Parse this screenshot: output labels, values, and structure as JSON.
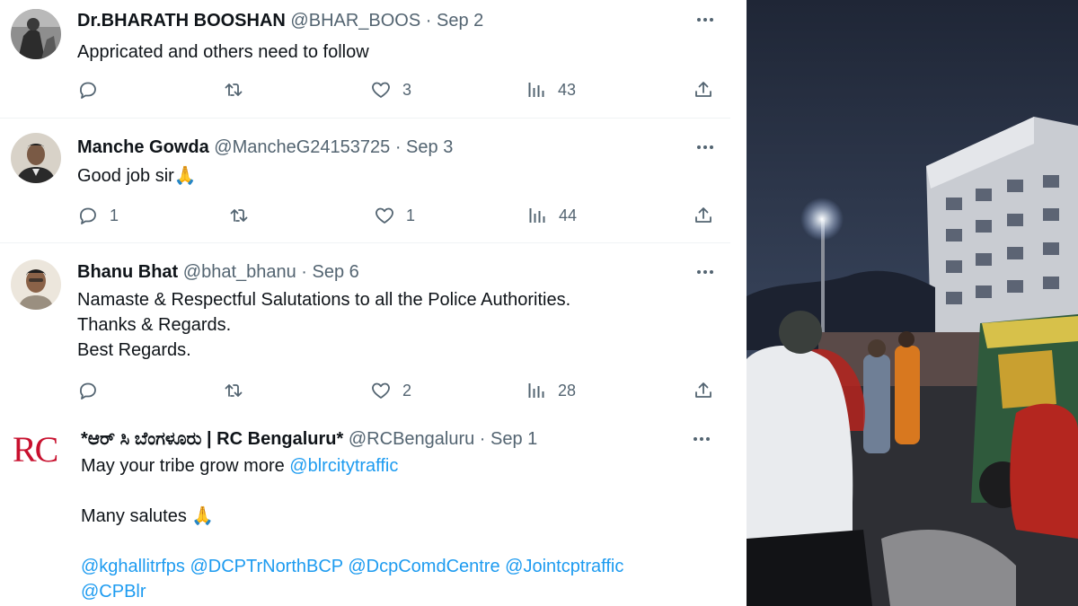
{
  "tweets": [
    {
      "author": "Dr.BHARATH BOOSHAN",
      "handle": "@BHAR_BOOS",
      "sep": " · ",
      "date": "Sep 2",
      "lines": [
        "Appricated and others need to follow"
      ],
      "replies": "",
      "retweets": "",
      "likes": "3",
      "views": "43"
    },
    {
      "author": "Manche Gowda",
      "handle": "@MancheG24153725",
      "sep": " · ",
      "date": "Sep 3",
      "lines": [
        "Good job sir🙏"
      ],
      "replies": "1",
      "retweets": "",
      "likes": "1",
      "views": "44"
    },
    {
      "author": "Bhanu Bhat",
      "handle": "@bhat_bhanu",
      "sep": " · ",
      "date": "Sep 6",
      "lines": [
        "Namaste & Respectful Salutations to all the Police Authorities.",
        "Thanks & Regards.",
        "Best Regards."
      ],
      "replies": "",
      "retweets": "",
      "likes": "2",
      "views": "28"
    },
    {
      "author": "*ಆರ್ ಸಿ ಬೆಂಗಳೂರು | RC Bengaluru*",
      "handle": "@RCBengaluru",
      "sep": " · ",
      "date": "Sep 1",
      "avatar_text": "RC",
      "line1_text": "May your tribe grow more ",
      "line1_mention": "@blrcitytraffic",
      "line2_text": "Many salutes 🙏",
      "mentions_line1": "@kghallitrfps @DCPTrNorthBCP @DcpComdCentre @Jointcptraffic",
      "mentions_line2": "@CPBlr"
    }
  ],
  "icons": {
    "reply": "reply-bubble-icon",
    "retweet": "retweet-arrows-icon",
    "like": "heart-icon",
    "views": "bar-chart-views-icon",
    "share": "share-upload-icon",
    "more": "more-dots-icon"
  },
  "colors": {
    "text": "#0f1419",
    "secondary": "#536471",
    "link": "#1d9bf0",
    "divider": "#eff3f4",
    "rc_logo": "#c8102e"
  }
}
